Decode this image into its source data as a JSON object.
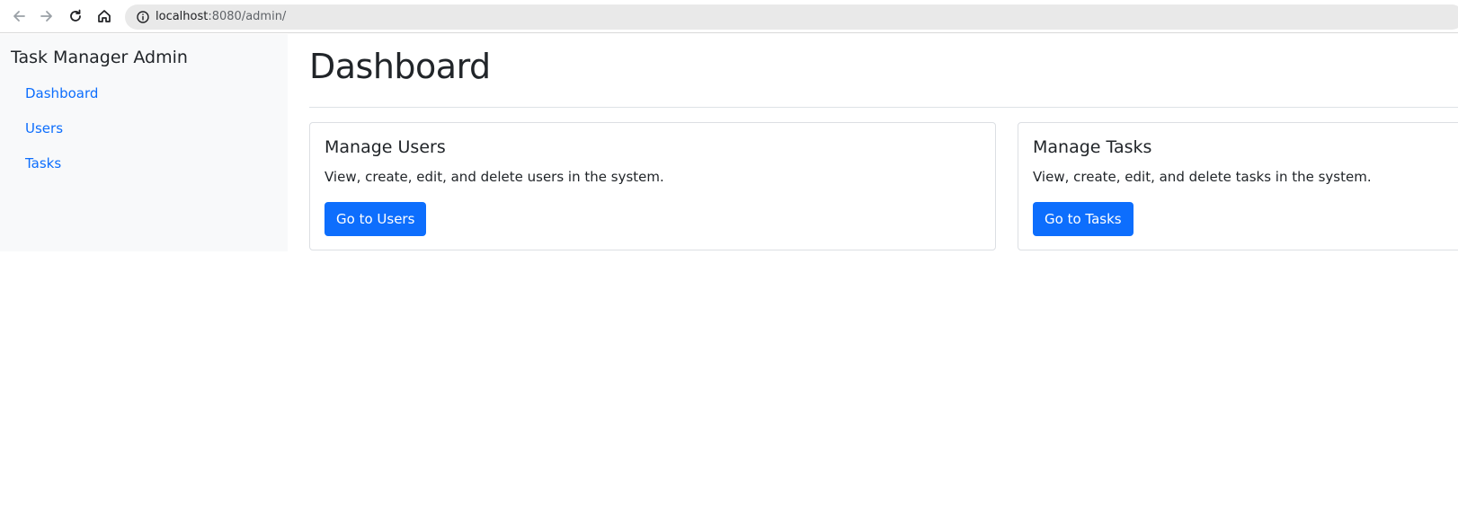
{
  "browser": {
    "url_host": "localhost",
    "url_rest": ":8080/admin/",
    "icons": [
      "back-arrow-icon",
      "forward-arrow-icon",
      "reload-icon",
      "home-icon",
      "info-icon"
    ]
  },
  "sidebar": {
    "title": "Task Manager Admin",
    "items": [
      {
        "label": "Dashboard"
      },
      {
        "label": "Users"
      },
      {
        "label": "Tasks"
      }
    ]
  },
  "main": {
    "title": "Dashboard",
    "cards": [
      {
        "title": "Manage Users",
        "text": "View, create, edit, and delete users in the system.",
        "button": "Go to Users"
      },
      {
        "title": "Manage Tasks",
        "text": "View, create, edit, and delete tasks in the system.",
        "button": "Go to Tasks"
      }
    ]
  },
  "colors": {
    "accent": "#0d6efd",
    "sidebar_bg": "#f8f9fa",
    "text": "#212529"
  }
}
